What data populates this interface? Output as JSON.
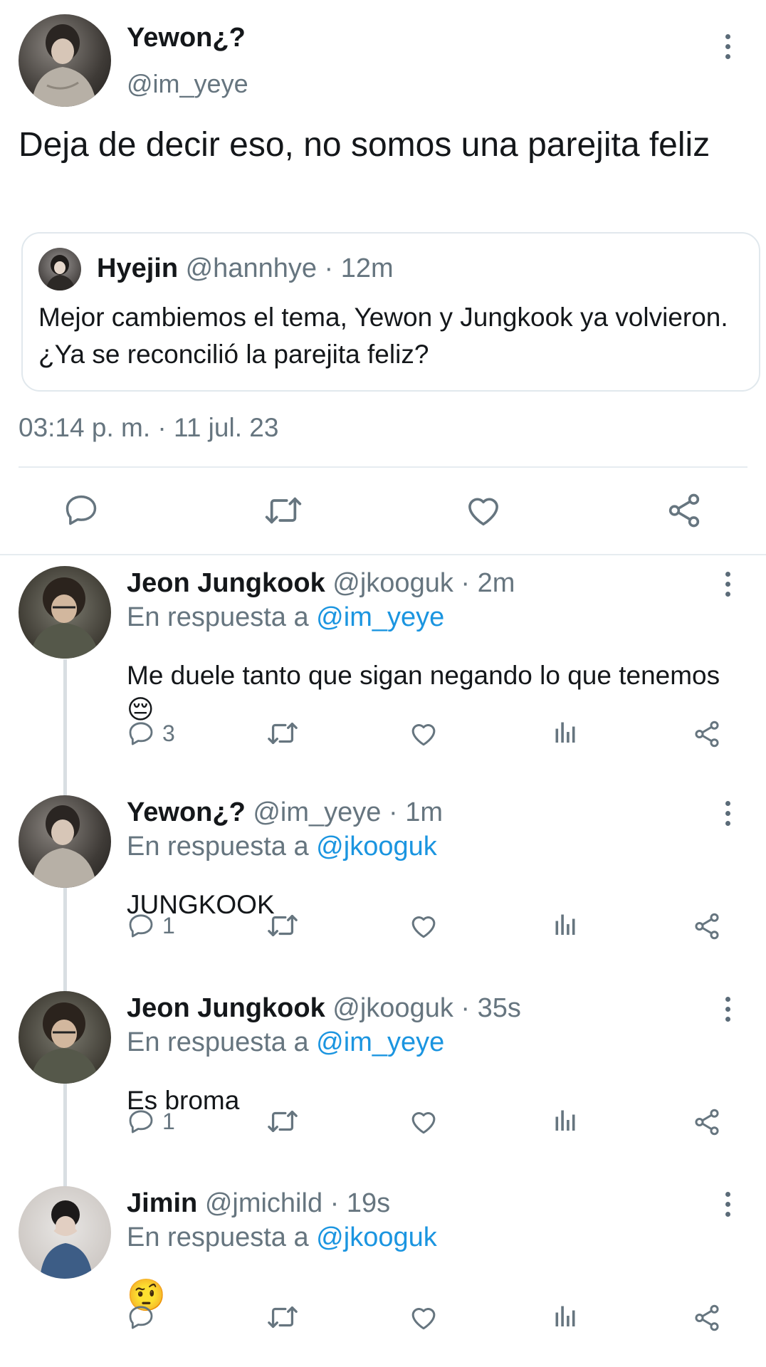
{
  "main_tweet": {
    "name": "Yewon¿?",
    "handle": "@im_yeye",
    "text": "Deja de decir eso, no somos una parejita feliz",
    "timestamp": "03:14 p. m. · 11 jul. 23",
    "quoted": {
      "name": "Hyejin",
      "meta": "@hannhye · 12m",
      "text": "Mejor cambiemos el tema, Yewon y Jungkook ya volvieron. ¿Ya se reconcilió la parejita feliz?"
    }
  },
  "replies": [
    {
      "name": "Jeon Jungkook",
      "meta": "@jkooguk · 2m",
      "reply_prefix": "En respuesta a",
      "reply_to": "@im_yeye",
      "text": "Me duele tanto que sigan negando lo que tenemos 😔",
      "reply_count": "3"
    },
    {
      "name": "Yewon¿?",
      "meta": "@im_yeye · 1m",
      "reply_prefix": "En respuesta a",
      "reply_to": "@jkooguk",
      "text": "JUNGKOOK",
      "reply_count": "1"
    },
    {
      "name": "Jeon Jungkook",
      "meta": "@jkooguk · 35s",
      "reply_prefix": "En respuesta a",
      "reply_to": "@im_yeye",
      "text": "Es broma",
      "reply_count": "1"
    },
    {
      "name": "Jimin",
      "meta": "@jmichild · 19s",
      "reply_prefix": "En respuesta a",
      "reply_to": "@jkooguk",
      "text": "🤨",
      "reply_count": ""
    }
  ],
  "colors": {
    "link": "#1b95e0",
    "muted": "#66757f",
    "text": "#14171a",
    "divider": "#e6ecf0"
  },
  "icons": [
    "reply-icon",
    "retweet-icon",
    "like-icon",
    "share-icon",
    "analytics-icon",
    "more-options-icon"
  ]
}
